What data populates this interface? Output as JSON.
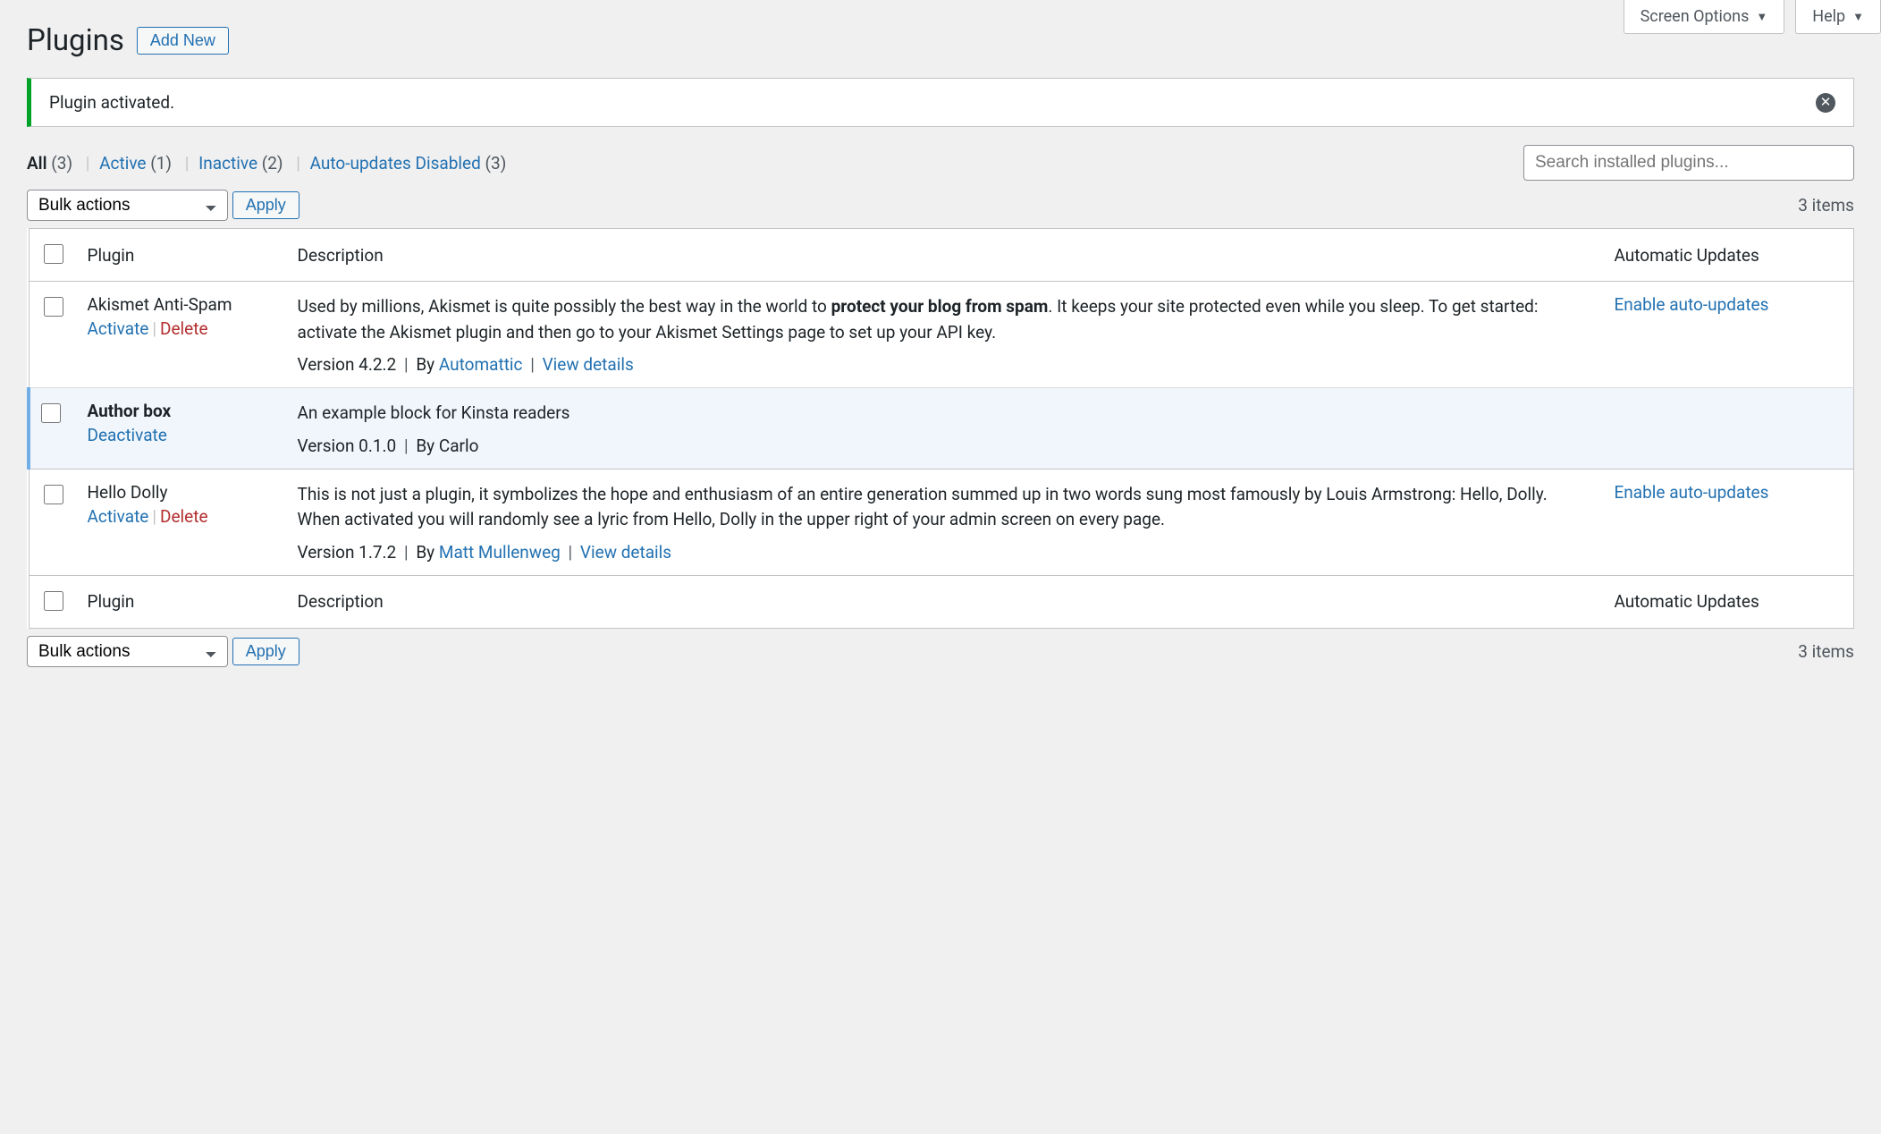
{
  "screen_options": {
    "label": "Screen Options"
  },
  "help": {
    "label": "Help"
  },
  "page_title": "Plugins",
  "add_new_label": "Add New",
  "notice": {
    "message": "Plugin activated."
  },
  "filters": {
    "all": {
      "label": "All",
      "count": "(3)"
    },
    "active": {
      "label": "Active",
      "count": "(1)"
    },
    "inactive": {
      "label": "Inactive",
      "count": "(2)"
    },
    "auto_disabled": {
      "label": "Auto-updates Disabled",
      "count": "(3)"
    }
  },
  "search": {
    "placeholder": "Search installed plugins..."
  },
  "bulk": {
    "label": "Bulk actions",
    "apply": "Apply"
  },
  "items_count": "3 items",
  "columns": {
    "plugin": "Plugin",
    "description": "Description",
    "auto": "Automatic Updates"
  },
  "actions": {
    "activate": "Activate",
    "deactivate": "Deactivate",
    "delete": "Delete",
    "view_details": "View details",
    "enable_auto": "Enable auto-updates"
  },
  "plugins": [
    {
      "name": "Akismet Anti-Spam",
      "active": false,
      "desc_pre": "Used by millions, Akismet is quite possibly the best way in the world to ",
      "desc_bold": "protect your blog from spam",
      "desc_post": ". It keeps your site protected even while you sleep. To get started: activate the Akismet plugin and then go to your Akismet Settings page to set up your API key.",
      "version": "Version 4.2.2",
      "by": "By ",
      "author": "Automattic",
      "has_details": true,
      "has_auto": true
    },
    {
      "name": "Author box",
      "active": true,
      "desc_pre": "An example block for Kinsta readers",
      "desc_bold": "",
      "desc_post": "",
      "version": "Version 0.1.0",
      "by": "By Carlo",
      "author": "",
      "has_details": false,
      "has_auto": false
    },
    {
      "name": "Hello Dolly",
      "active": false,
      "desc_pre": "This is not just a plugin, it symbolizes the hope and enthusiasm of an entire generation summed up in two words sung most famously by Louis Armstrong: Hello, Dolly. When activated you will randomly see a lyric from Hello, Dolly in the upper right of your admin screen on every page.",
      "desc_bold": "",
      "desc_post": "",
      "version": "Version 1.7.2",
      "by": "By ",
      "author": "Matt Mullenweg",
      "has_details": true,
      "has_auto": true
    }
  ]
}
